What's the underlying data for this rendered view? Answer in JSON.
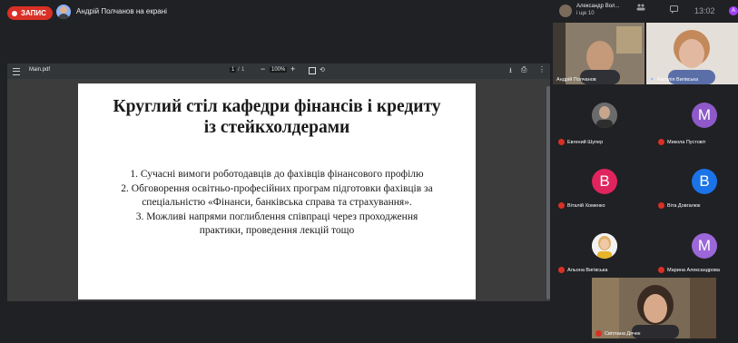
{
  "recording": {
    "label": "ЗАПИС"
  },
  "presenter": {
    "label": "Андрій Полчанов на екрані"
  },
  "pdf_viewer": {
    "file_name": "Main.pdf",
    "page_current": "1",
    "page_separator": "/",
    "page_total": "1",
    "zoom_out": "−",
    "zoom_level": "100%",
    "zoom_in": "+",
    "download": "⭳",
    "print": "⎙",
    "more": "⋮",
    "rotate": "⟲"
  },
  "slide": {
    "title_line1": "Круглий стіл кафедри фінансів і кредиту",
    "title_line2": "із стейкхолдерами",
    "items": [
      "1. Сучасні вимоги роботодавців до фахівців фінансового профілю",
      "2. Обговорення освітньо-професійних програм підготовки фахівців за",
      "спеціальністю «Фінанси, банківська справа та страхування».",
      "3. Можливі напрями поглиблення співпраці через проходження",
      "практики, проведення лекцій тощо"
    ]
  },
  "top_right": {
    "account_name": "Александр Вол...",
    "account_sub": "і ще 10",
    "chat": "💬",
    "time": "13:02",
    "btn_round": "А"
  },
  "participants": [
    {
      "name": "Андрій Полчанов",
      "type": "video"
    },
    {
      "name": "Наталія Вигівська",
      "type": "video"
    },
    {
      "name": "Евгений Шупер",
      "type": "photo"
    },
    {
      "name": "Микола Пустовіт",
      "type": "letter",
      "letter": "М",
      "color": "#8e59c8"
    },
    {
      "name": "Віталій Хоменко",
      "type": "letter",
      "letter": "В",
      "color": "#e0245e"
    },
    {
      "name": "Віта Довгалюк",
      "type": "letter",
      "letter": "В",
      "color": "#1a73e8"
    },
    {
      "name": "Альона Вигівська",
      "type": "photo"
    },
    {
      "name": "Марина Александрова",
      "type": "letter",
      "letter": "М",
      "color": "#9c67d9"
    },
    {
      "name": "Світлана Дячек",
      "type": "video"
    }
  ]
}
